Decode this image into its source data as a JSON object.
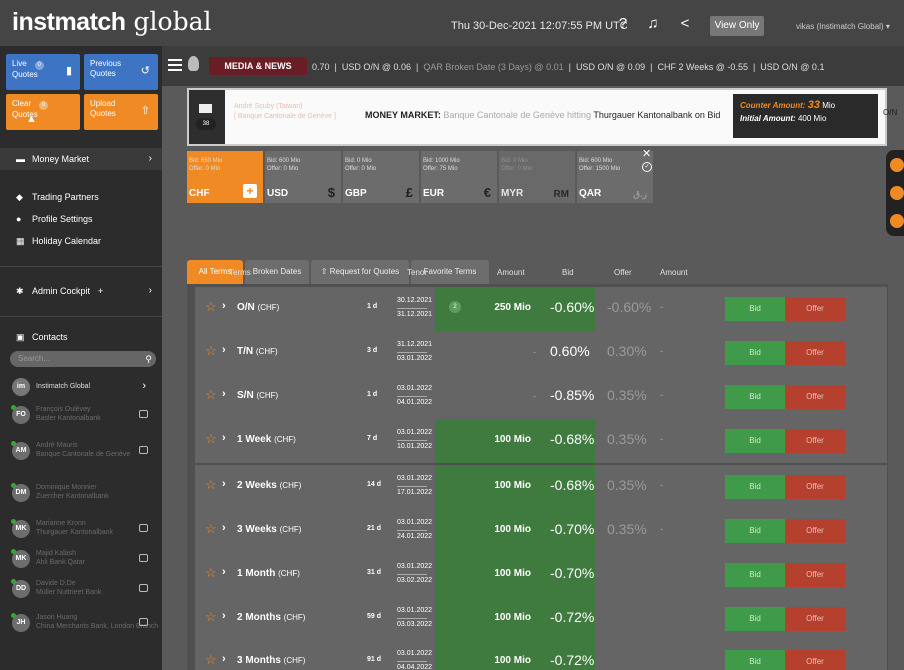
{
  "header": {
    "logo_bold": "instmatch",
    "logo_light": "global",
    "clock": "Thu 30-Dec-2021 12:07:55 PM UTC",
    "view_only": "View Only",
    "user": "vikas (Instimatch Global)"
  },
  "sidebar": {
    "live_quotes": {
      "label1": "Live",
      "label2": "Quotes",
      "count": "0"
    },
    "previous_quotes": {
      "label1": "Previous",
      "label2": "Quotes"
    },
    "clear_quotes": {
      "label1": "Clear",
      "label2": "Quotes",
      "count": "0"
    },
    "upload_quotes": {
      "label1": "Upload",
      "label2": "Quotes"
    },
    "money_market": "Money Market",
    "trading_partners": "Trading Partners",
    "profile_settings": "Profile Settings",
    "holiday_calendar": "Holiday Calendar",
    "admin_cockpit": "Admin Cockpit",
    "contacts": "Contacts",
    "search_placeholder": "Search...",
    "contacts_list": [
      {
        "initials": "IG",
        "name": "Instimatch Global",
        "sub": ""
      },
      {
        "initials": "FO",
        "name": "François Oulévey",
        "sub": "Basler Kantonalbank"
      },
      {
        "initials": "AM",
        "name": "André Mauris",
        "sub": "Banque Cantonale de Genève"
      },
      {
        "initials": "DM",
        "name": "Dominique Monnier",
        "sub": "Zuercher Kantonalbank"
      },
      {
        "initials": "MK",
        "name": "Marianne Kronn",
        "sub": "Thurgauer Kantonalbank"
      },
      {
        "initials": "MK",
        "name": "Majid Kalash",
        "sub": "Ahli Bank Qatar"
      },
      {
        "initials": "DD",
        "name": "Davide D.De",
        "sub": "Müller Nuttrieet Bank"
      },
      {
        "initials": "JH",
        "name": "Jason Huang",
        "sub": "China Merchants Bank, London Branch"
      }
    ]
  },
  "ticker": {
    "media_news": "MEDIA & NEWS",
    "items": [
      "0.70",
      "USD O/N @ 0.06",
      "QAR Broken Date (3 Days) @ 0.01",
      "USD O/N @ 0.09",
      "CHF 2 Weeks @ -0.55",
      "USD O/N @ 0.1"
    ]
  },
  "news": {
    "count": "38",
    "source_name": "André Scuby (Taiwan)",
    "source_bank": "[ Banque Cantonale de Genève ]",
    "label": "MONEY MARKET:",
    "text_faded": "Banque Cantonale de Genève hitting",
    "text": "Thurgauer Kantonalbank on Bid",
    "counter_label": "Counter Amount:",
    "counter_value": "33",
    "counter_unit": "Mio",
    "initial_label": "Initial Amount:",
    "initial_value": "400 Mio",
    "tail": "O/N"
  },
  "currencies": [
    {
      "bid": "Bid: 650 Mio",
      "offer": "Offer: 0 Mio",
      "code": "CHF",
      "sym": "+"
    },
    {
      "bid": "Bid: 600 Mio",
      "offer": "Offer: 0 Mio",
      "code": "USD",
      "sym": "$"
    },
    {
      "bid": "Bid: 0 Mio",
      "offer": "Offer: 0 Mio",
      "code": "GBP",
      "sym": "£"
    },
    {
      "bid": "Bid: 1000 Mio",
      "offer": "Offer: 75 Mio",
      "code": "EUR",
      "sym": "€"
    },
    {
      "bid": "Bid: 0 Mio",
      "offer": "Offer: 0 Mio",
      "code": "MYR",
      "sym": "RM"
    },
    {
      "bid": "Bid: 600 Mio",
      "offer": "Offer: 1500 Mio",
      "code": "QAR",
      "sym": "ر.ق"
    }
  ],
  "tabs": [
    "All Terms",
    "Broken Dates",
    "Request for Quotes",
    "Favorite Terms"
  ],
  "columns": {
    "terms": "Terms",
    "tenor": "Tenor",
    "amount": "Amount",
    "bid": "Bid",
    "offer": "Offer",
    "amount2": "Amount"
  },
  "buttons": {
    "bid": "Bid",
    "offer": "Offer"
  },
  "rows": [
    {
      "term": "O/N",
      "ccy": "(CHF)",
      "days": "1 d",
      "d1": "30.12.2021",
      "d2": "31.12.2021",
      "badge": "2",
      "amount": "250 Mio",
      "bid": "-0.60%",
      "offer": "-0.60%",
      "dash": "",
      "odash": "-"
    },
    {
      "term": "T/N",
      "ccy": "(CHF)",
      "days": "3 d",
      "d1": "31.12.2021",
      "d2": "03.01.2022",
      "badge": "",
      "amount": "",
      "bid": "0.60%",
      "offer": "0.30%",
      "dash": "-",
      "odash": "-"
    },
    {
      "term": "S/N",
      "ccy": "(CHF)",
      "days": "1 d",
      "d1": "03.01.2022",
      "d2": "04.01.2022",
      "badge": "",
      "amount": "",
      "bid": "-0.85%",
      "offer": "0.35%",
      "dash": "-",
      "odash": "-"
    },
    {
      "term": "1 Week",
      "ccy": "(CHF)",
      "days": "7 d",
      "d1": "03.01.2022",
      "d2": "10.01.2022",
      "badge": "",
      "amount": "100 Mio",
      "bid": "-0.68%",
      "offer": "0.35%",
      "dash": "",
      "odash": "-"
    },
    {
      "term": "2 Weeks",
      "ccy": "(CHF)",
      "days": "14 d",
      "d1": "03.01.2022",
      "d2": "17.01.2022",
      "badge": "",
      "amount": "100 Mio",
      "bid": "-0.68%",
      "offer": "0.35%",
      "dash": "",
      "odash": "-"
    },
    {
      "term": "3 Weeks",
      "ccy": "(CHF)",
      "days": "21 d",
      "d1": "03.01.2022",
      "d2": "24.01.2022",
      "badge": "",
      "amount": "100 Mio",
      "bid": "-0.70%",
      "offer": "0.35%",
      "dash": "",
      "odash": "-"
    },
    {
      "term": "1 Month",
      "ccy": "(CHF)",
      "days": "31 d",
      "d1": "03.01.2022",
      "d2": "03.02.2022",
      "badge": "",
      "amount": "100 Mio",
      "bid": "-0.70%",
      "offer": "",
      "dash": "",
      "odash": ""
    },
    {
      "term": "2 Months",
      "ccy": "(CHF)",
      "days": "59 d",
      "d1": "03.01.2022",
      "d2": "03.03.2022",
      "badge": "",
      "amount": "100 Mio",
      "bid": "-0.72%",
      "offer": "",
      "dash": "",
      "odash": ""
    },
    {
      "term": "3 Months",
      "ccy": "(CHF)",
      "days": "91 d",
      "d1": "03.01.2022",
      "d2": "04.04.2022",
      "badge": "",
      "amount": "100 Mio",
      "bid": "-0.72%",
      "offer": "",
      "dash": "",
      "odash": ""
    }
  ],
  "colors": {
    "accent": "#f08a24",
    "blue": "#3d74c4",
    "bid_green": "#3f9a4a",
    "offer_red": "#b5402e",
    "media_red": "#6b1d26"
  }
}
